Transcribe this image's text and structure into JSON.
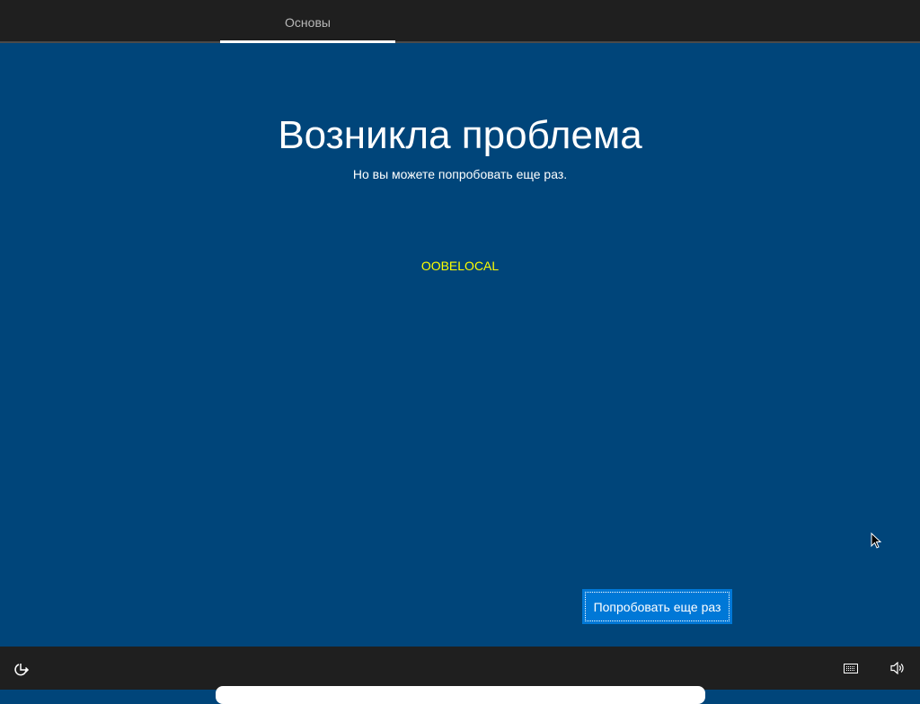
{
  "header": {
    "tab": "Основы"
  },
  "main": {
    "title": "Возникла проблема",
    "subtitle": "Но вы можете попробовать еще раз.",
    "error_code": "OOBELOCAL",
    "retry_button": "Попробовать еще раз"
  },
  "footer": {
    "icons": [
      "ease-of-access-icon",
      "keyboard-icon",
      "volume-icon"
    ]
  },
  "colors": {
    "background": "#00457a",
    "button": "#0078d7",
    "error_code": "#ffff00",
    "bars": "#1f1f1f"
  }
}
